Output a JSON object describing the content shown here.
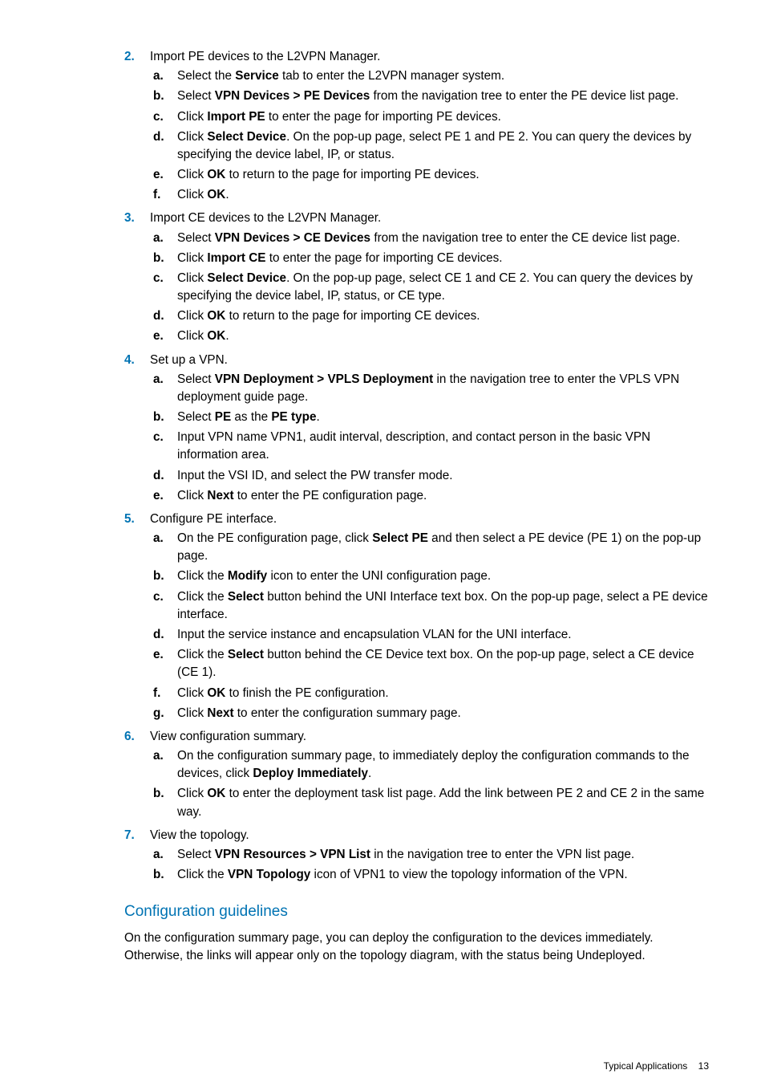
{
  "steps": [
    {
      "num": "2.",
      "text": "Import PE devices to the L2VPN Manager.",
      "subs": [
        {
          "m": "a.",
          "parts": [
            "Select the ",
            {
              "b": "Service"
            },
            " tab to enter the L2VPN manager system."
          ]
        },
        {
          "m": "b.",
          "parts": [
            "Select ",
            {
              "b": "VPN Devices > PE Devices"
            },
            " from the navigation tree to enter the PE device list page."
          ]
        },
        {
          "m": "c.",
          "parts": [
            "Click ",
            {
              "b": "Import PE"
            },
            "  to enter the page for importing PE devices."
          ]
        },
        {
          "m": "d.",
          "parts": [
            "Click ",
            {
              "b": "Select Device"
            },
            ". On the pop-up page, select PE 1 and PE 2. You can query the devices by specifying the device label, IP, or status."
          ]
        },
        {
          "m": "e.",
          "parts": [
            "Click ",
            {
              "b": "OK"
            },
            " to return to the page for importing PE devices."
          ]
        },
        {
          "m": "f.",
          "parts": [
            "Click ",
            {
              "b": "OK"
            },
            "."
          ]
        }
      ]
    },
    {
      "num": "3.",
      "text": "Import CE devices to the L2VPN Manager.",
      "subs": [
        {
          "m": "a.",
          "parts": [
            "Select ",
            {
              "b": "VPN Devices > CE Devices"
            },
            " from the navigation tree to enter the CE device list page."
          ]
        },
        {
          "m": "b.",
          "parts": [
            "Click ",
            {
              "b": "Import CE"
            },
            " to enter the page for importing CE devices."
          ]
        },
        {
          "m": "c.",
          "parts": [
            "Click ",
            {
              "b": "Select Device"
            },
            ". On the pop-up page, select CE 1 and CE 2. You can query the devices by specifying the device label, IP, status, or CE type."
          ]
        },
        {
          "m": "d.",
          "parts": [
            "Click ",
            {
              "b": "OK"
            },
            " to return to the page for importing CE devices."
          ]
        },
        {
          "m": "e.",
          "parts": [
            "Click ",
            {
              "b": "OK"
            },
            "."
          ]
        }
      ]
    },
    {
      "num": "4.",
      "text": "Set up a VPN.",
      "subs": [
        {
          "m": "a.",
          "parts": [
            "Select ",
            {
              "b": "VPN Deployment > VPLS Deployment"
            },
            " in the navigation tree to enter the VPLS VPN deployment guide page."
          ]
        },
        {
          "m": "b.",
          "parts": [
            "Select ",
            {
              "b": "PE"
            },
            " as the ",
            {
              "b": "PE type"
            },
            "."
          ]
        },
        {
          "m": "c.",
          "parts": [
            "Input VPN name VPN1, audit interval, description, and contact person in the basic VPN information area."
          ]
        },
        {
          "m": "d.",
          "parts": [
            "Input the VSI ID, and select the PW transfer mode."
          ]
        },
        {
          "m": "e.",
          "parts": [
            "Click ",
            {
              "b": "Next"
            },
            " to enter the PE configuration page."
          ]
        }
      ]
    },
    {
      "num": "5.",
      "text": "Configure PE interface.",
      "subs": [
        {
          "m": "a.",
          "parts": [
            "On the PE configuration page, click ",
            {
              "b": "Select PE"
            },
            " and then select a PE device (PE 1) on the pop-up page."
          ]
        },
        {
          "m": "b.",
          "parts": [
            "Click the ",
            {
              "b": "Modify"
            },
            " icon to enter the UNI configuration page."
          ]
        },
        {
          "m": "c.",
          "parts": [
            "Click the ",
            {
              "b": "Select"
            },
            " button behind the UNI Interface text box. On the pop-up page, select a PE device interface."
          ]
        },
        {
          "m": "d.",
          "parts": [
            "Input the service instance and encapsulation VLAN for the UNI interface."
          ]
        },
        {
          "m": "e.",
          "parts": [
            "Click the ",
            {
              "b": "Select"
            },
            " button behind the CE Device text box. On the pop-up page, select a CE device (CE 1)."
          ]
        },
        {
          "m": "f.",
          "parts": [
            "Click ",
            {
              "b": "OK"
            },
            " to finish the PE configuration."
          ]
        },
        {
          "m": "g.",
          "parts": [
            "Click ",
            {
              "b": "Next"
            },
            " to enter the configuration summary page."
          ]
        }
      ]
    },
    {
      "num": "6.",
      "text": "View configuration summary.",
      "subs": [
        {
          "m": "a.",
          "parts": [
            "On the configuration summary page, to immediately deploy the configuration commands to the devices, click ",
            {
              "b": "Deploy Immediately"
            },
            "."
          ]
        },
        {
          "m": "b.",
          "parts": [
            "Click ",
            {
              "b": "OK"
            },
            " to enter the deployment task list page. Add the link between PE 2 and CE 2 in the same way."
          ]
        }
      ]
    },
    {
      "num": "7.",
      "text": "View the topology.",
      "subs": [
        {
          "m": "a.",
          "parts": [
            "Select ",
            {
              "b": "VPN Resources > VPN List"
            },
            " in the navigation tree to enter the VPN list page."
          ]
        },
        {
          "m": "b.",
          "parts": [
            "Click the ",
            {
              "b": "VPN Topology"
            },
            " icon of VPN1 to view the topology information of the VPN."
          ]
        }
      ]
    }
  ],
  "guidelines_heading": "Configuration guidelines",
  "guidelines_text": "On the configuration summary page, you can deploy the configuration to the devices immediately. Otherwise, the links will appear only on the topology diagram, with the status being Undeployed.",
  "footer_text": "Typical Applications",
  "footer_page": "13"
}
